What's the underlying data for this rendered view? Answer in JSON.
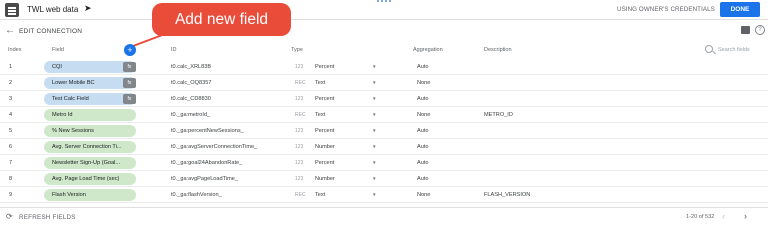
{
  "topbar": {
    "title": "TWL web data",
    "owner_credentials": "USING OWNER'S CREDENTIALS",
    "done": "DONE"
  },
  "callout": {
    "text": "Add new field"
  },
  "editbar": {
    "title": "EDIT CONNECTION"
  },
  "columns": {
    "index": "Index",
    "field": "Field",
    "id": "ID",
    "type": "Type",
    "aggregation": "Aggregation",
    "description": "Description"
  },
  "add_button": {
    "symbol": "+"
  },
  "search": {
    "placeholder": "Search fields"
  },
  "rows": [
    {
      "index": "1",
      "field": "CQI",
      "kind": "calc",
      "color": "blue",
      "id": "t0.calc_XRL83B",
      "type_icon": "123",
      "type": "Percent",
      "aggregation": "Auto",
      "description": ""
    },
    {
      "index": "2",
      "field": "Lower Mobile BC",
      "kind": "calc",
      "color": "blue",
      "id": "t0.calc_OQ8357",
      "type_icon": "REC",
      "type": "Text",
      "aggregation": "None",
      "description": ""
    },
    {
      "index": "3",
      "field": "Test Calc Field",
      "kind": "calc",
      "color": "blue",
      "id": "t0.calc_CD8830",
      "type_icon": "123",
      "type": "Percent",
      "aggregation": "Auto",
      "description": ""
    },
    {
      "index": "4",
      "field": "Metro Id",
      "kind": "dim",
      "color": "green",
      "id": "t0._ga:metroId_",
      "type_icon": "REC",
      "type": "Text",
      "aggregation": "None",
      "description": "METRO_ID"
    },
    {
      "index": "5",
      "field": "% New Sessions",
      "kind": "dim",
      "color": "green",
      "id": "t0._ga:percentNewSessions_",
      "type_icon": "123",
      "type": "Percent",
      "aggregation": "Auto",
      "description": ""
    },
    {
      "index": "6",
      "field": "Avg. Server Connection Ti...",
      "kind": "dim",
      "color": "green",
      "id": "t0._ga:avgServerConnectionTime_",
      "type_icon": "123",
      "type": "Number",
      "aggregation": "Auto",
      "description": ""
    },
    {
      "index": "7",
      "field": "Newsletter Sign-Up (Goal...",
      "kind": "dim",
      "color": "green",
      "id": "t0._ga:goal24AbandonRate_",
      "type_icon": "123",
      "type": "Percent",
      "aggregation": "Auto",
      "description": ""
    },
    {
      "index": "8",
      "field": "Avg. Page Load Time (sec)",
      "kind": "dim",
      "color": "green",
      "id": "t0._ga:avgPageLoadTime_",
      "type_icon": "123",
      "type": "Number",
      "aggregation": "Auto",
      "description": ""
    },
    {
      "index": "9",
      "field": "Flash Version",
      "kind": "dim",
      "color": "green",
      "id": "t0._ga:flashVersion_",
      "type_icon": "REC",
      "type": "Text",
      "aggregation": "None",
      "description": "FLASH_VERSION"
    }
  ],
  "fx_label": "fx",
  "footer": {
    "refresh": "REFRESH FIELDS",
    "page_info": "1-20 of 532"
  }
}
